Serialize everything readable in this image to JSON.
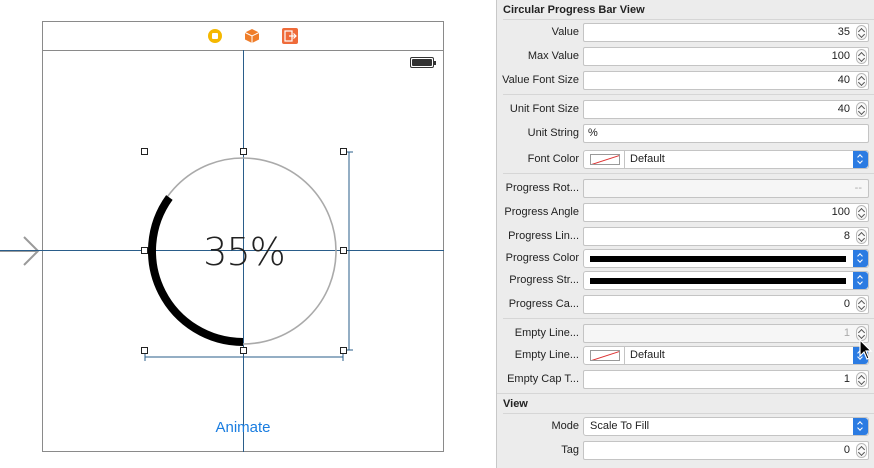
{
  "canvas": {
    "animate_label": "Animate",
    "progress_text": "35%",
    "progress_value": 35,
    "progress_max": 100,
    "progress_color": "#000000",
    "empty_line_color": "#aaaaaa",
    "guide_color": "#2a5d8a",
    "scene_icons": [
      "record-icon",
      "cube-icon",
      "exit-icon"
    ]
  },
  "inspector": {
    "section_circular": "Circular Progress Bar View",
    "rows": [
      {
        "label": "Value",
        "value": "35"
      },
      {
        "label": "Max Value",
        "value": "100"
      },
      {
        "label": "Value Font Size",
        "value": "40"
      },
      {
        "label": "Unit Font Size",
        "value": "40"
      },
      {
        "label": "Unit String",
        "value": "%"
      },
      {
        "label": "Font Color",
        "value": "Default"
      },
      {
        "label": "Progress Rot...",
        "value": "--"
      },
      {
        "label": "Progress Angle",
        "value": "100"
      },
      {
        "label": "Progress Lin...",
        "value": "8"
      },
      {
        "label": "Progress Color",
        "value": ""
      },
      {
        "label": "Progress Str...",
        "value": ""
      },
      {
        "label": "Progress Ca...",
        "value": "0"
      },
      {
        "label": "Empty Line...",
        "value": "1"
      },
      {
        "label": "Empty Line...",
        "value": "Default"
      },
      {
        "label": "Empty Cap T...",
        "value": "1"
      }
    ],
    "section_view": "View",
    "mode_label": "Mode",
    "mode_value": "Scale To Fill",
    "tag_label": "Tag",
    "tag_value": "0"
  }
}
